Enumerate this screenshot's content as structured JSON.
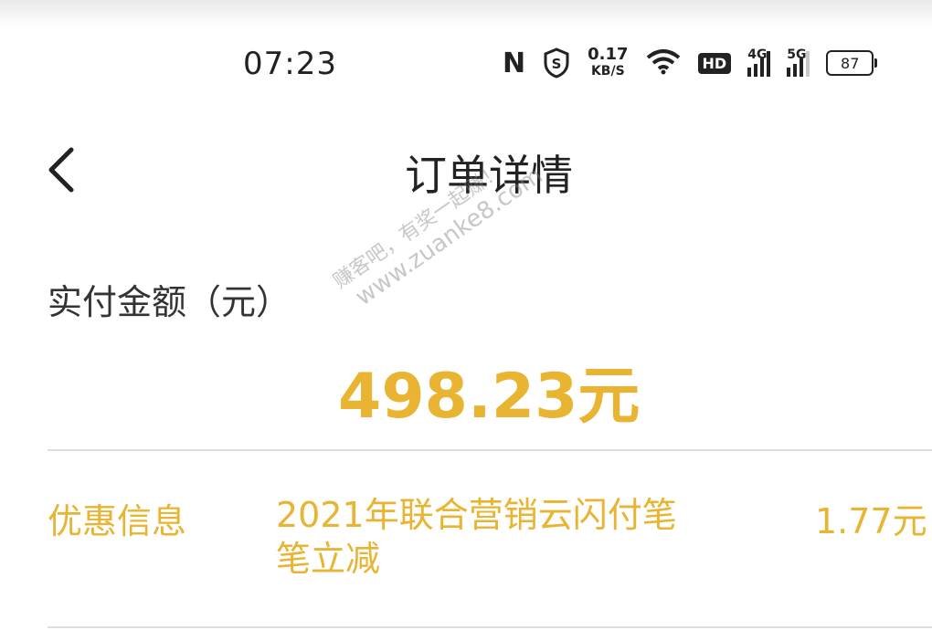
{
  "status_bar": {
    "time": "07:23",
    "net_speed_value": "0.17",
    "net_speed_unit": "KB/S",
    "hd_badge": "HD",
    "signal1_label": "4G",
    "signal2_label": "5G",
    "battery": "87"
  },
  "header": {
    "title": "订单详情"
  },
  "amount": {
    "label": "实付金额（元）",
    "value": "498.23元"
  },
  "discount": {
    "label": "优惠信息",
    "description": "2021年联合营销云闪付笔笔立减",
    "amount": "1.77元"
  },
  "watermark": {
    "line1": "赚客吧，有奖一起赚！",
    "line2": "www.zuanke8.com"
  },
  "colors": {
    "accent": "#e8b431",
    "text": "#333333",
    "divider": "#dddddd"
  }
}
